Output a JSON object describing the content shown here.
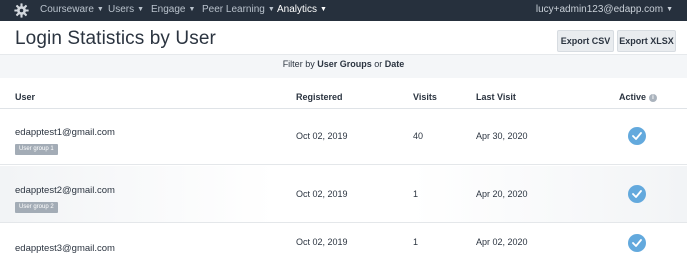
{
  "nav": {
    "items": [
      {
        "label": "Courseware",
        "active": false
      },
      {
        "label": "Users",
        "active": false
      },
      {
        "label": "Engage",
        "active": false
      },
      {
        "label": "Peer Learning",
        "active": false
      },
      {
        "label": "Analytics",
        "active": true
      }
    ],
    "user_email": "lucy+admin123@edapp.com"
  },
  "header": {
    "title": "Login Statistics by User",
    "export_csv_label": "Export CSV",
    "export_xlsx_label": "Export XLSX"
  },
  "filter": {
    "prefix": "Filter by",
    "groups_label": "User Groups",
    "conjunction": "or",
    "date_label": "Date"
  },
  "table": {
    "columns": {
      "user": "User",
      "registered": "Registered",
      "visits": "Visits",
      "last_visit": "Last Visit",
      "active": "Active"
    },
    "rows": [
      {
        "email": "edapptest1@gmail.com",
        "group": "User group 1",
        "registered": "Oct 02, 2019",
        "visits": "40",
        "last_visit": "Apr 30, 2020",
        "active": true
      },
      {
        "email": "edapptest2@gmail.com",
        "group": "User group 2",
        "registered": "Oct 02, 2019",
        "visits": "1",
        "last_visit": "Apr 20, 2020",
        "active": true
      },
      {
        "email": "edapptest3@gmail.com",
        "group": "",
        "registered": "Oct 02, 2019",
        "visits": "1",
        "last_visit": "Apr 02, 2020",
        "active": true
      }
    ]
  },
  "colors": {
    "nav_bg": "#26303d",
    "accent_check": "#63a9dd",
    "badge_bg": "#a3acb6"
  }
}
